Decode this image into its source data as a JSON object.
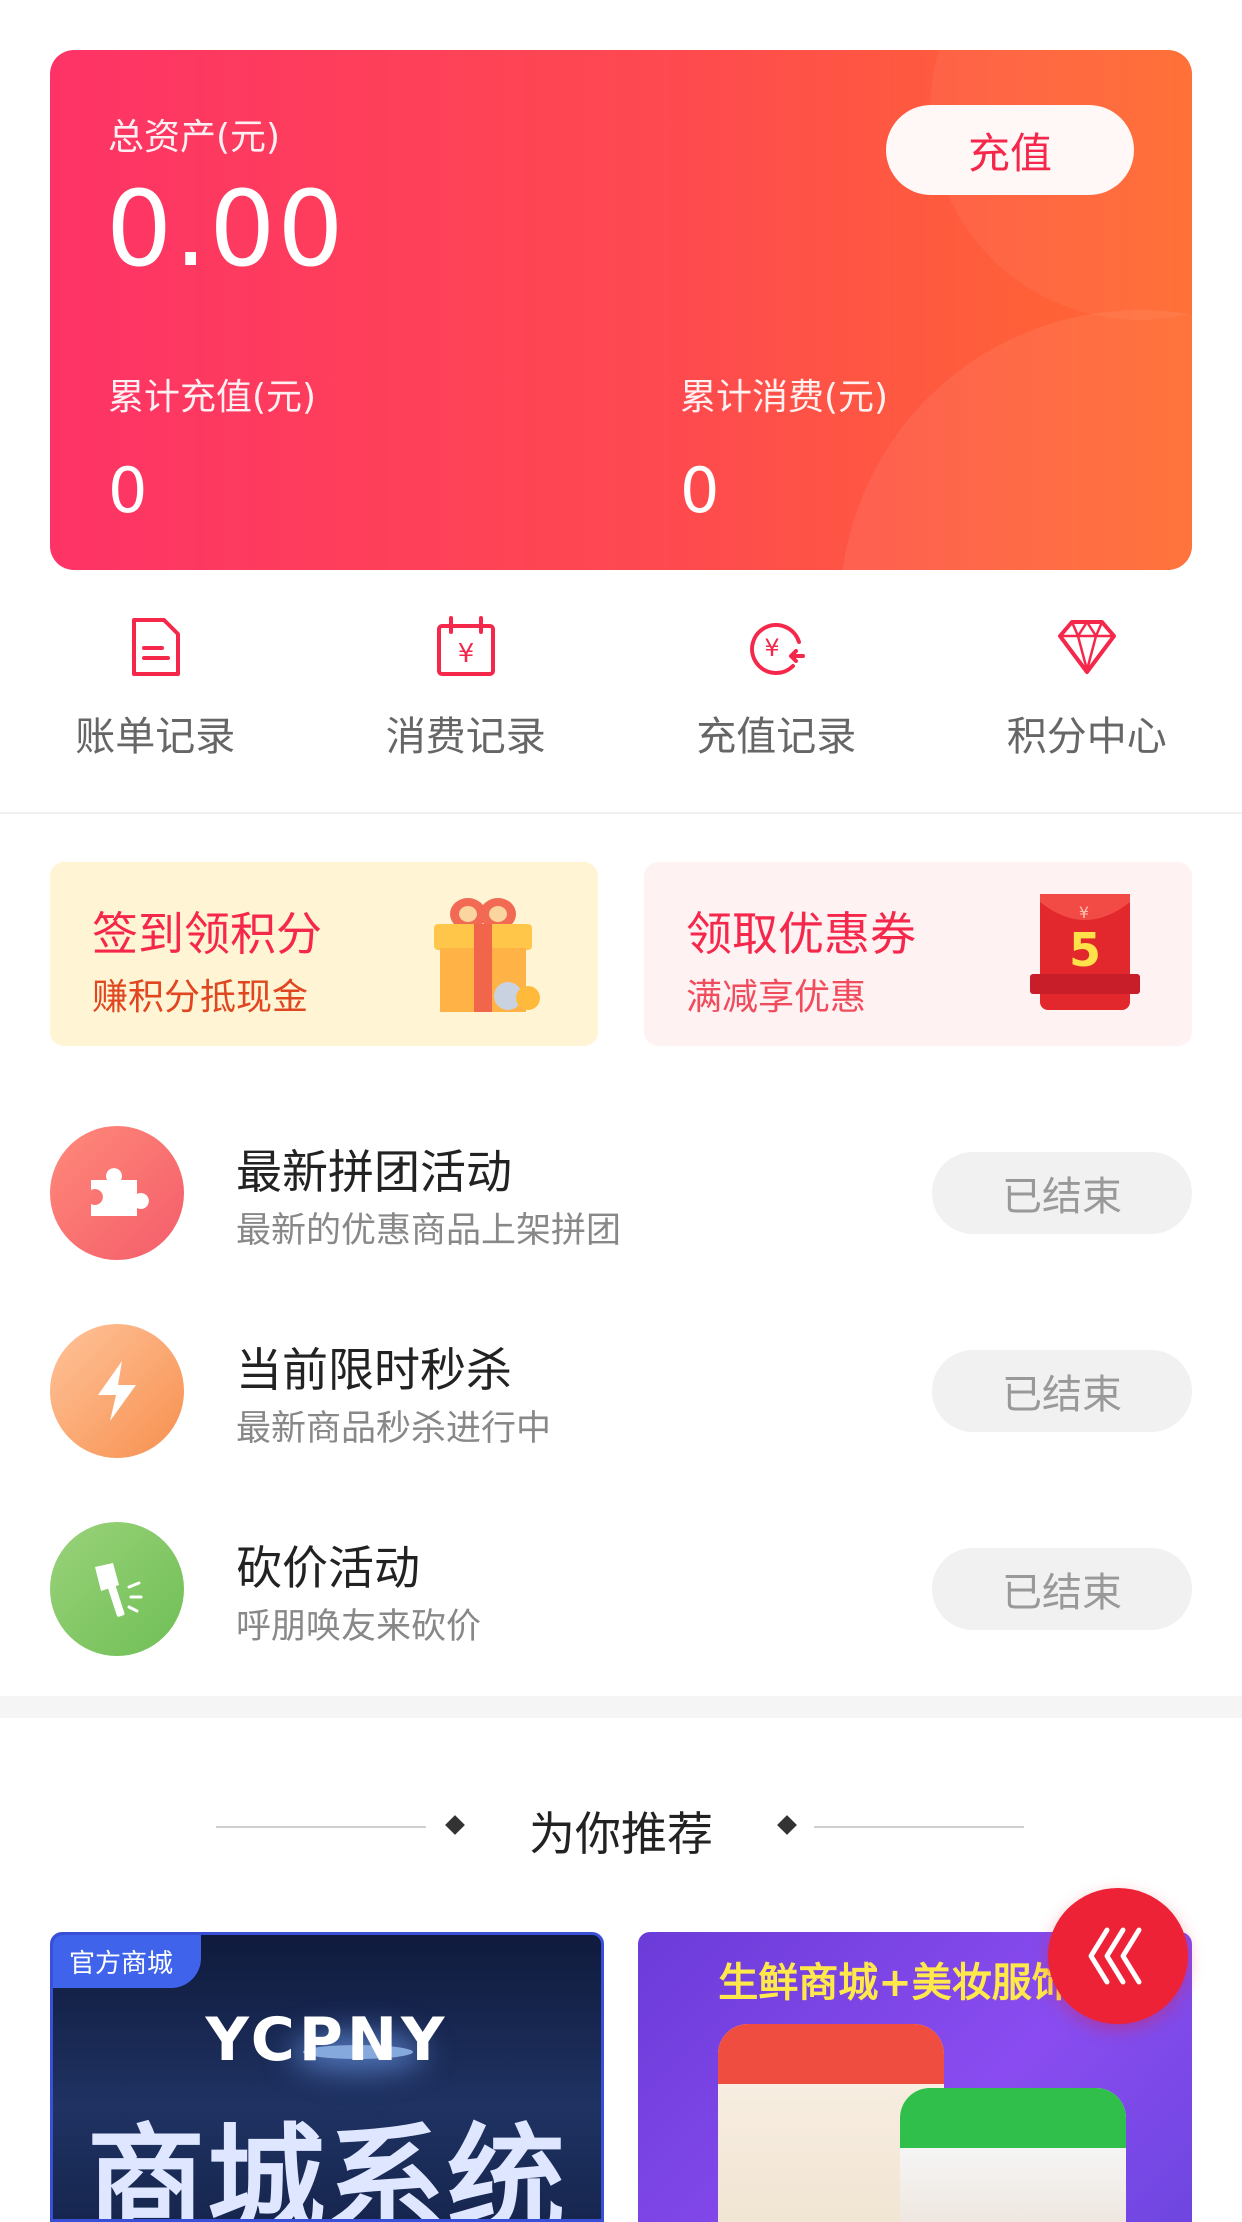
{
  "asset": {
    "total_label": "总资产(元)",
    "total_value": "0.00",
    "recharge_button": "充值",
    "cumulative_recharge_label": "累计充值(元)",
    "cumulative_recharge_value": "0",
    "cumulative_spend_label": "累计消费(元)",
    "cumulative_spend_value": "0"
  },
  "quick_nav": [
    {
      "label": "账单记录",
      "icon": "bill-icon"
    },
    {
      "label": "消费记录",
      "icon": "calendar-yuan-icon"
    },
    {
      "label": "充值记录",
      "icon": "recharge-refresh-icon"
    },
    {
      "label": "积分中心",
      "icon": "diamond-icon"
    }
  ],
  "promos": {
    "signin": {
      "title": "签到领积分",
      "subtitle": "赚积分抵现金",
      "icon": "gift-box-icon"
    },
    "coupon": {
      "title": "领取优惠券",
      "subtitle": "满减享优惠",
      "icon": "red-envelope-icon",
      "badge": "5"
    }
  },
  "activities": [
    {
      "title": "最新拼团活动",
      "subtitle": "最新的优惠商品上架拼团",
      "status": "已结束",
      "icon": "puzzle-icon"
    },
    {
      "title": "当前限时秒杀",
      "subtitle": "最新商品秒杀进行中",
      "status": "已结束",
      "icon": "lightning-icon"
    },
    {
      "title": "砍价活动",
      "subtitle": "呼朋唤友来砍价",
      "status": "已结束",
      "icon": "axe-icon"
    }
  ],
  "recommend": {
    "title": "为你推荐",
    "products": [
      {
        "tag": "官方商城",
        "brand": "YCPNY",
        "headline": "商城系统"
      },
      {
        "banner": "生鲜商城+美妆服饰商"
      }
    ]
  },
  "colors": {
    "primary": "#f5284c",
    "gradient_start": "#fd3366",
    "gradient_end": "#ff6a2e",
    "signin_bg": "#fff4d3",
    "coupon_bg": "#fff2f2",
    "status_bg": "#f1f1f1"
  },
  "fab": {
    "icon": "chevron-left-triple-icon"
  }
}
